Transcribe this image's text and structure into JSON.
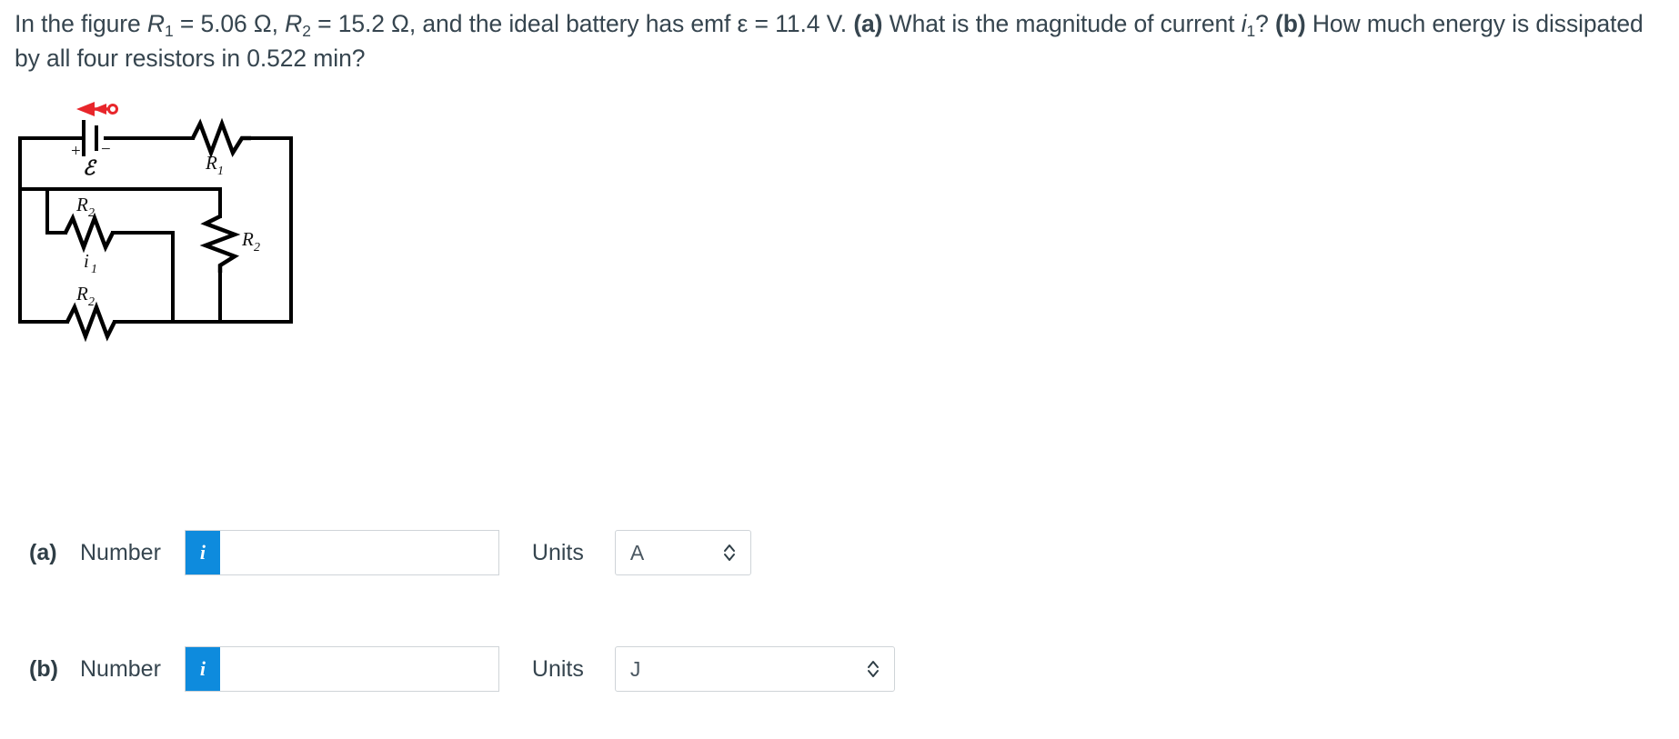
{
  "question": {
    "line1_prefix": "In the figure ",
    "r1_symbol": "R",
    "r1_sub": "1",
    "r1_value": " = 5.06 Ω, ",
    "r2_symbol": "R",
    "r2_sub": "2",
    "r2_value": " = 15.2 Ω, and the ideal battery has emf ε = 11.4 V. ",
    "part_a_tag": "(a)",
    "part_a_text": " What is the magnitude of current ",
    "current_symbol": "i",
    "current_sub": "1",
    "current_suffix": "? ",
    "part_b_tag": "(b)",
    "part_b_text": " How much energy is dissipated by all four resistors in 0.522 min?",
    "full_text": "In the figure R1 = 5.06 Ω, R2 = 15.2 Ω, and the ideal battery has emf ε = 11.4 V. (a) What is the magnitude of current i1? (b) How much energy is dissipated by all four resistors in 0.522 min?"
  },
  "figure": {
    "alt": "circuit diagram",
    "battery_label": "ℰ",
    "battery_plus": "+",
    "battery_minus": "−",
    "r1_label": "R",
    "r1_sub": "1",
    "r2_top_label": "R",
    "r2_top_sub": "2",
    "r2_right_label": "R",
    "r2_right_sub": "2",
    "r2_bottom_label": "R",
    "r2_bottom_sub": "2",
    "current_label": "i",
    "current_sub": "1",
    "arrow_color": "#e8262b",
    "wire_color": "#000000"
  },
  "answers": [
    {
      "id": "a",
      "part_label": "(a)",
      "number_label": "Number",
      "info_icon": "info-icon",
      "info_glyph": "i",
      "number_value": "",
      "number_placeholder": "",
      "units_label": "Units",
      "units_value": "A",
      "chevron_icon": "chevron-up-down-icon"
    },
    {
      "id": "b",
      "part_label": "(b)",
      "number_label": "Number",
      "info_icon": "info-icon",
      "info_glyph": "i",
      "number_value": "",
      "number_placeholder": "",
      "units_label": "Units",
      "units_value": "J",
      "chevron_icon": "chevron-up-down-icon"
    }
  ],
  "colors": {
    "accent_blue": "#0e8bdd",
    "text": "#36454f",
    "border": "#cfd4d8",
    "arrow_red": "#e8262b"
  }
}
